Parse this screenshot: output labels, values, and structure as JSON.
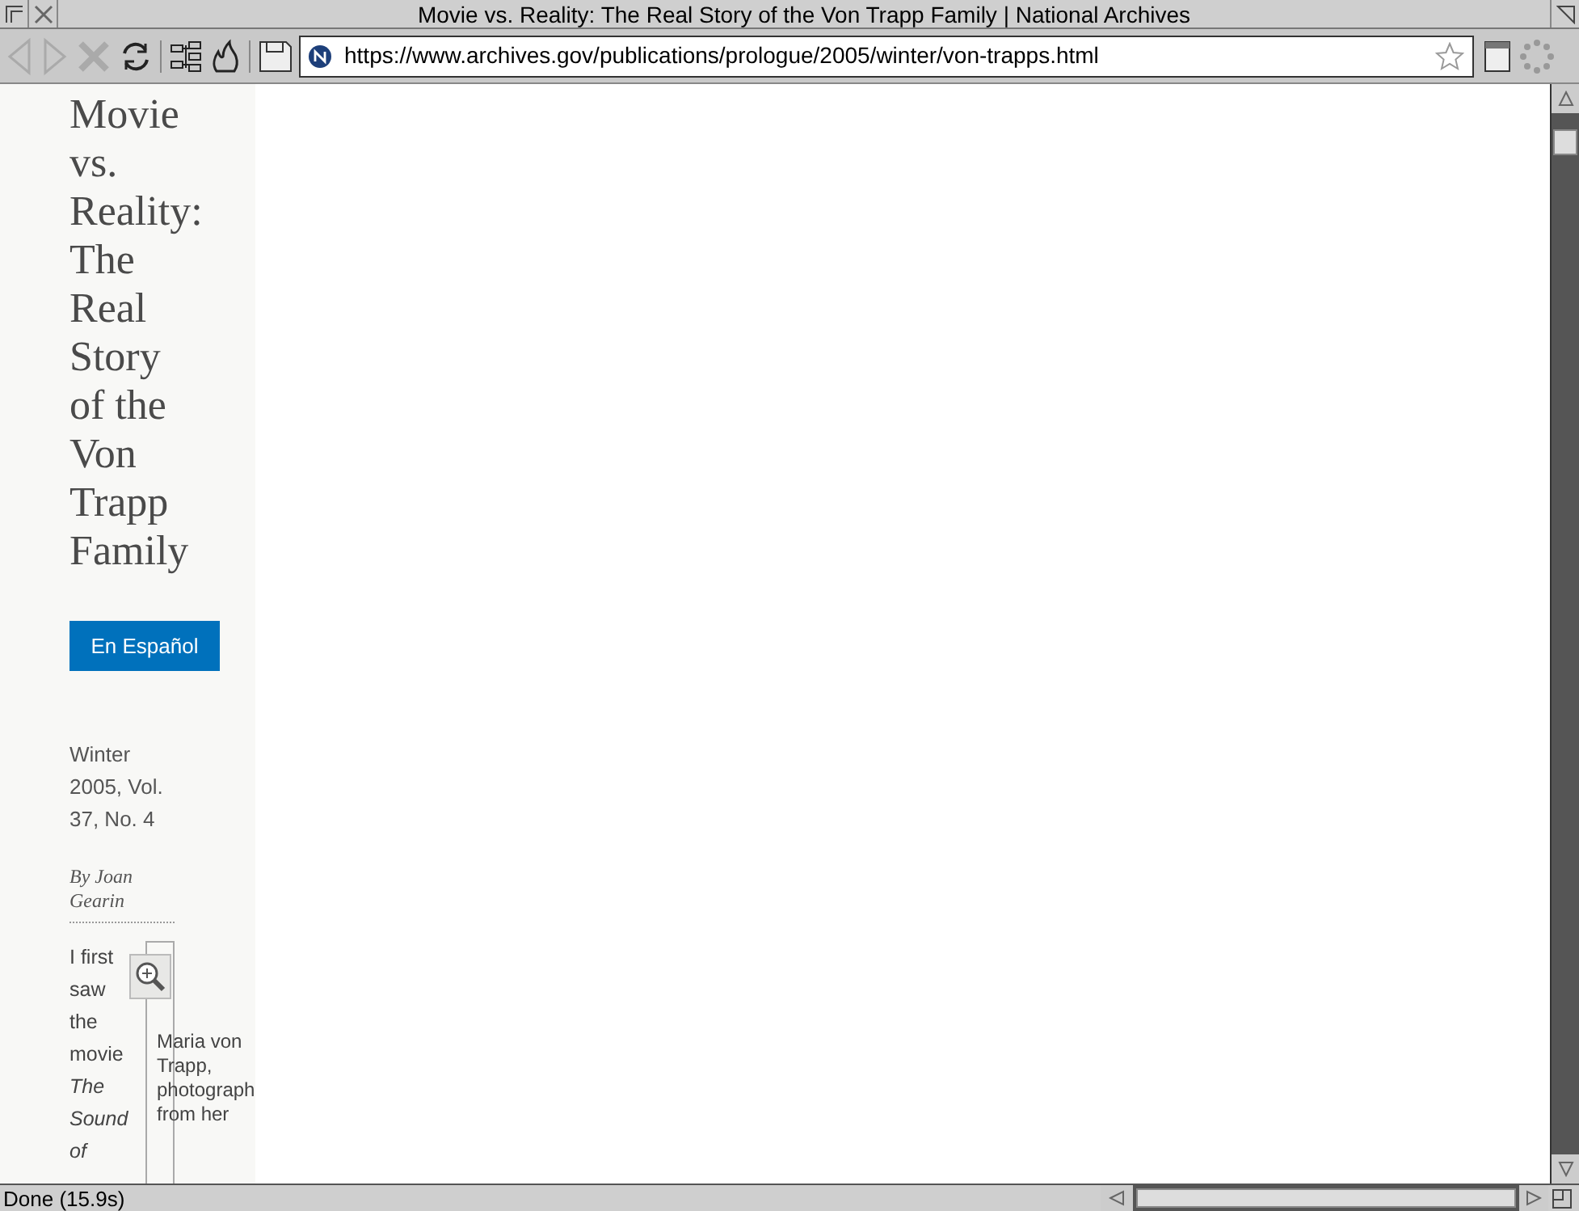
{
  "window": {
    "title": "Movie vs. Reality: The Real Story of the Von Trapp Family | National Archives"
  },
  "address_bar": {
    "url": "https://www.archives.gov/publications/prologue/2005/winter/von-trapps.html"
  },
  "article": {
    "title": "Movie vs. Reality: The Real Story of the Von Trapp Family",
    "language_button": "En Español",
    "issue": "Winter 2005, Vol. 37, No. 4",
    "byline": "By Joan Gearin",
    "paragraph": "I first saw the movie *The Sound of*",
    "image_caption": "Maria von Trapp, photograph from her"
  },
  "status_bar": {
    "text": "Done (15.9s)"
  }
}
